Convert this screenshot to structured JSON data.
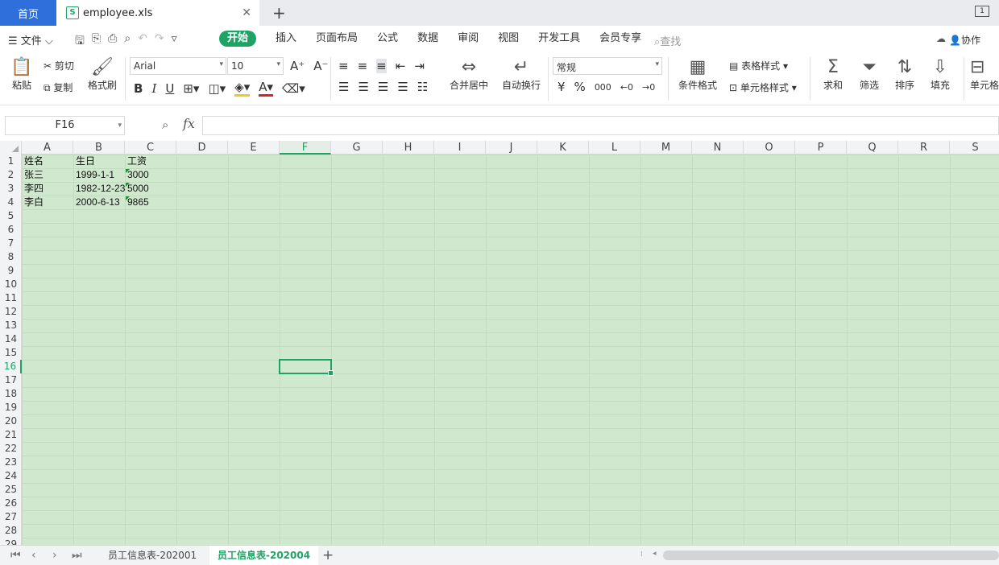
{
  "app_tabs": {
    "home": "首页",
    "file_name": "employee.xls",
    "window_count": "1"
  },
  "menu": {
    "file": "文件",
    "tabs": [
      "开始",
      "插入",
      "页面布局",
      "公式",
      "数据",
      "审阅",
      "视图",
      "开发工具",
      "会员专享"
    ],
    "active_tab": "开始",
    "search": "查找",
    "collab": "协作"
  },
  "ribbon": {
    "paste": "粘贴",
    "cut": "剪切",
    "copy": "复制",
    "format_painter": "格式刷",
    "font_name": "Arial",
    "font_size": "10",
    "merge_center": "合并居中",
    "wrap_text": "自动换行",
    "number_format": "常规",
    "currency": "¥",
    "percent": "%",
    "thousands": "000",
    "cond_format": "条件格式",
    "table_style": "表格样式",
    "cell_style": "单元格样式",
    "sum": "求和",
    "filter": "筛选",
    "sort": "排序",
    "fill": "填充",
    "cell": "单元格"
  },
  "formula_bar": {
    "name_box": "F16",
    "fx": "fx",
    "content": ""
  },
  "columns": [
    "A",
    "B",
    "C",
    "D",
    "E",
    "F",
    "G",
    "H",
    "I",
    "J",
    "K",
    "L",
    "M",
    "N",
    "O",
    "P",
    "Q",
    "R",
    "S"
  ],
  "rows": [
    "1",
    "2",
    "3",
    "4",
    "5",
    "6",
    "7",
    "8",
    "9",
    "10",
    "11",
    "12",
    "13",
    "14",
    "15",
    "16",
    "17",
    "18",
    "19",
    "20",
    "21",
    "22",
    "23",
    "24",
    "25",
    "26",
    "27",
    "28",
    "29"
  ],
  "active_cell": {
    "col": "F",
    "row": "16"
  },
  "cells": {
    "A1": "姓名",
    "B1": "生日",
    "C1": "工资",
    "A2": "张三",
    "B2": "1999-1-1",
    "C2": "3000",
    "A3": "李四",
    "B3": "1982-12-23",
    "C3": "5000",
    "A4": "李白",
    "B4": "2000-6-13",
    "C4": "9865"
  },
  "sheets": [
    "员工信息表-202001",
    "员工信息表-202004"
  ],
  "active_sheet": "员工信息表-202004",
  "colors": {
    "accent": "#1fa365",
    "home_tab": "#2f6fdc",
    "cell_bg": "#d0e8cd"
  }
}
